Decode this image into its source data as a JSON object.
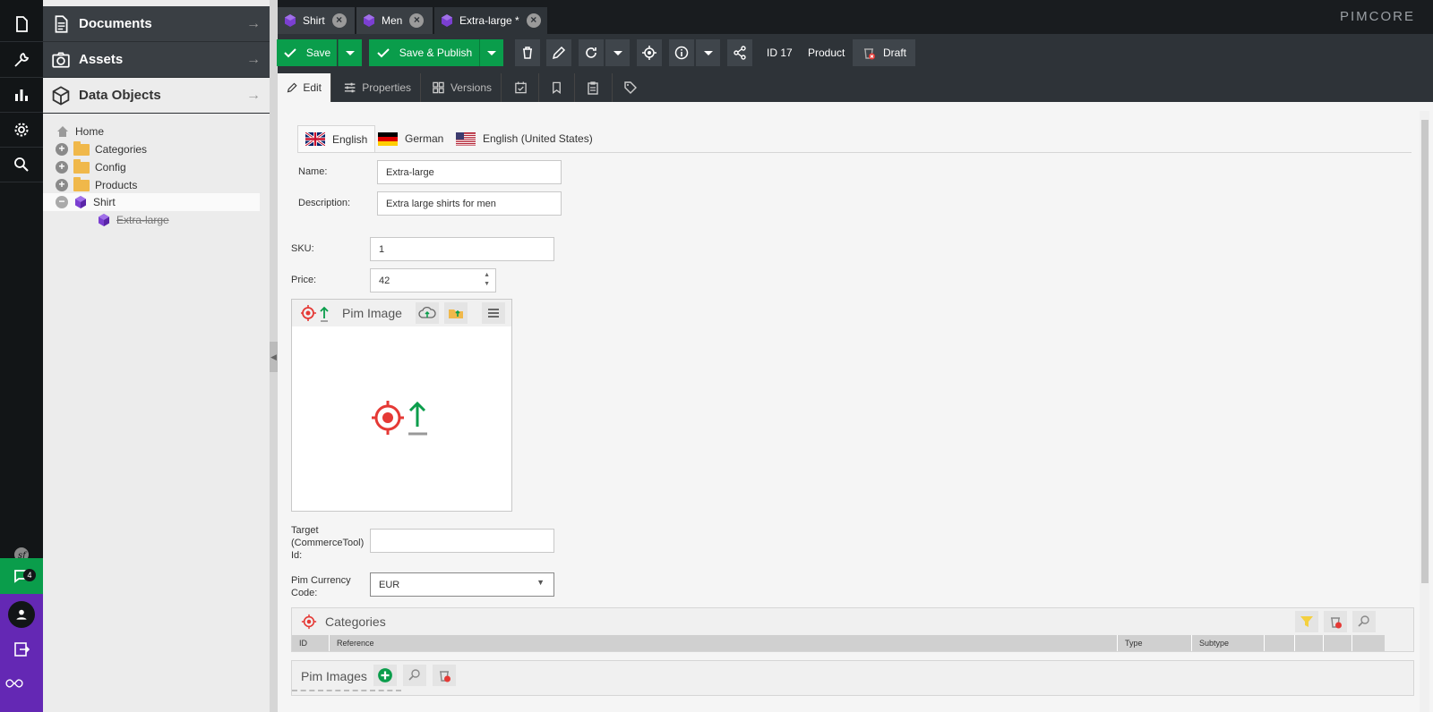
{
  "sidebar": {
    "accordions": [
      {
        "label": "Documents",
        "icon": "document-icon"
      },
      {
        "label": "Assets",
        "icon": "camera-icon"
      },
      {
        "label": "Data Objects",
        "icon": "cube-icon"
      }
    ],
    "tree": [
      {
        "label": "Home"
      },
      {
        "label": "Categories"
      },
      {
        "label": "Config"
      },
      {
        "label": "Products"
      },
      {
        "label": "Shirt"
      },
      {
        "label": "Extra-large"
      }
    ],
    "notification_count": "4"
  },
  "tabs": [
    {
      "label": "Shirt"
    },
    {
      "label": "Men"
    },
    {
      "label": "Extra-large *"
    }
  ],
  "logo": "PIMCORE",
  "toolbar": {
    "save": "Save",
    "save_publish": "Save & Publish",
    "id": "ID 17",
    "type": "Product",
    "draft": "Draft"
  },
  "subtabs": {
    "edit": "Edit",
    "properties": "Properties",
    "versions": "Versions"
  },
  "languages": [
    {
      "label": "English"
    },
    {
      "label": "German"
    },
    {
      "label": "English (United States)"
    }
  ],
  "form": {
    "name_label": "Name:",
    "name_value": "Extra-large",
    "description_label": "Description:",
    "description_value": "Extra large shirts for men",
    "sku_label": "SKU:",
    "sku_value": "1",
    "price_label": "Price:",
    "price_value": "42",
    "pim_image_title": "Pim Image",
    "target_label_1": "Target",
    "target_label_2": "(CommerceTool)",
    "target_label_3": "Id:",
    "target_value": "",
    "currency_label_1": "Pim Currency",
    "currency_label_2": "Code:",
    "currency_value": "EUR"
  },
  "categories": {
    "title": "Categories",
    "columns": [
      "ID",
      "Reference",
      "Type",
      "Subtype"
    ]
  },
  "pim_images": {
    "title": "Pim Images"
  },
  "colors": {
    "accent_green": "#0a9d4b",
    "target_red": "#e53935",
    "sidebar_purple": "#6428b4"
  }
}
